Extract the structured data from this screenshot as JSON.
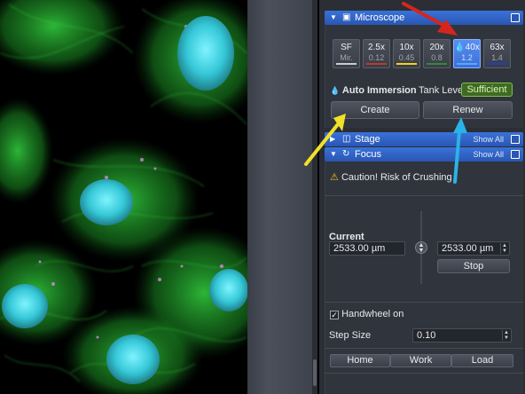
{
  "microscope": {
    "title": "Microscope",
    "objectives": [
      {
        "mag": "SF",
        "na": "Mir.",
        "bar_color": "#c8ccd4",
        "active": false
      },
      {
        "mag": "2.5x",
        "na": "0.12",
        "bar_color": "#c0392b",
        "active": false
      },
      {
        "mag": "10x",
        "na": "0.45",
        "bar_color": "#f1d21f",
        "active": false
      },
      {
        "mag": "20x",
        "na": "0.8",
        "bar_color": "#2e8b3a",
        "active": false
      },
      {
        "mag": "40x",
        "na": "1.2",
        "bar_color": "#5aa6ff",
        "active": true,
        "drop": "💧"
      },
      {
        "mag": "63x",
        "na": "1.4",
        "bar_color": "#1f3fbf",
        "active": false
      }
    ],
    "auto_immersion_label": "Auto Immersion",
    "tank_level_label": "Tank Level",
    "tank_level_value": "Sufficient",
    "create_label": "Create",
    "renew_label": "Renew"
  },
  "stage": {
    "title": "Stage",
    "show_all": "Show All"
  },
  "focus": {
    "title": "Focus",
    "show_all": "Show All",
    "caution": "Caution! Risk of Crushing",
    "current_label": "Current",
    "current_value": "2533.00 µm",
    "target_value": "2533.00 µm",
    "stop_label": "Stop",
    "handwheel_label": "Handwheel on",
    "step_size_label": "Step Size",
    "step_size_value": "0.10",
    "home_label": "Home",
    "work_label": "Work",
    "load_label": "Load"
  },
  "annotation_colors": {
    "red": "#d6261c",
    "yellow": "#f2e12a",
    "blue": "#2ab3e6"
  }
}
